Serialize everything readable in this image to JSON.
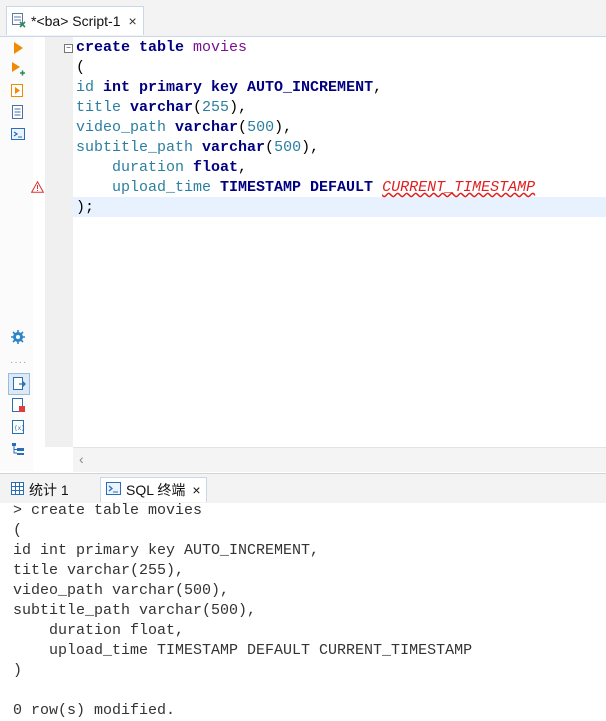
{
  "editor_tab": {
    "label": "*<ba> Script-1",
    "close": "×"
  },
  "code_lines": [
    {
      "tokens": [
        {
          "t": "create table ",
          "c": "kw"
        },
        {
          "t": "movies",
          "c": "table-name"
        }
      ]
    },
    {
      "tokens": [
        {
          "t": "(",
          "c": "punc"
        }
      ]
    },
    {
      "tokens": [
        {
          "t": "id ",
          "c": "ident"
        },
        {
          "t": "int primary key ",
          "c": "kw"
        },
        {
          "t": "AUTO_INCREMENT",
          "c": "ai"
        },
        {
          "t": ",",
          "c": "punc"
        }
      ]
    },
    {
      "tokens": [
        {
          "t": "title ",
          "c": "ident"
        },
        {
          "t": "varchar",
          "c": "kw"
        },
        {
          "t": "(",
          "c": "punc"
        },
        {
          "t": "255",
          "c": "num"
        },
        {
          "t": "),",
          "c": "punc"
        }
      ]
    },
    {
      "tokens": [
        {
          "t": "video_path ",
          "c": "ident"
        },
        {
          "t": "varchar",
          "c": "kw"
        },
        {
          "t": "(",
          "c": "punc"
        },
        {
          "t": "500",
          "c": "num"
        },
        {
          "t": "),",
          "c": "punc"
        }
      ]
    },
    {
      "tokens": [
        {
          "t": "subtitle_path ",
          "c": "ident"
        },
        {
          "t": "varchar",
          "c": "kw"
        },
        {
          "t": "(",
          "c": "punc"
        },
        {
          "t": "500",
          "c": "num"
        },
        {
          "t": "),",
          "c": "punc"
        }
      ]
    },
    {
      "tokens": [
        {
          "t": "    duration ",
          "c": "ident"
        },
        {
          "t": "float",
          "c": "kw"
        },
        {
          "t": ",",
          "c": "punc"
        }
      ]
    },
    {
      "tokens": [
        {
          "t": "    upload_time ",
          "c": "ident"
        },
        {
          "t": "TIMESTAMP DEFAULT ",
          "c": "ai"
        },
        {
          "t": "CURRENT_TIMESTAMP",
          "c": "func-err"
        }
      ]
    },
    {
      "tokens": [
        {
          "t": ");",
          "c": "punc"
        }
      ]
    }
  ],
  "panel_tabs": {
    "stats_label": "统计 1",
    "sql_terminal_label": "SQL 终端",
    "close": "×"
  },
  "console_lines": [
    "> create table movies",
    "(",
    "id int primary key AUTO_INCREMENT,",
    "title varchar(255),",
    "video_path varchar(500),",
    "subtitle_path varchar(500),",
    "    duration float,",
    "    upload_time TIMESTAMP DEFAULT CURRENT_TIMESTAMP",
    ")",
    "",
    "0 row(s) modified."
  ],
  "icons": {
    "toolbar": [
      "execute-statement-icon",
      "execute-script-icon",
      "execute-new-tab-icon",
      "explain-plan-icon",
      "sql-terminal-icon",
      "settings-icon",
      "export-icon",
      "new-script-icon",
      "variables-icon",
      "outline-icon"
    ],
    "warning": "warning-icon",
    "scroll_left": "‹"
  },
  "colors": {
    "keyword": "#000080",
    "identifier": "#2a7fa0",
    "table": "#7b0f91",
    "error": "#e02020",
    "current_line": "#e8f2fe"
  }
}
